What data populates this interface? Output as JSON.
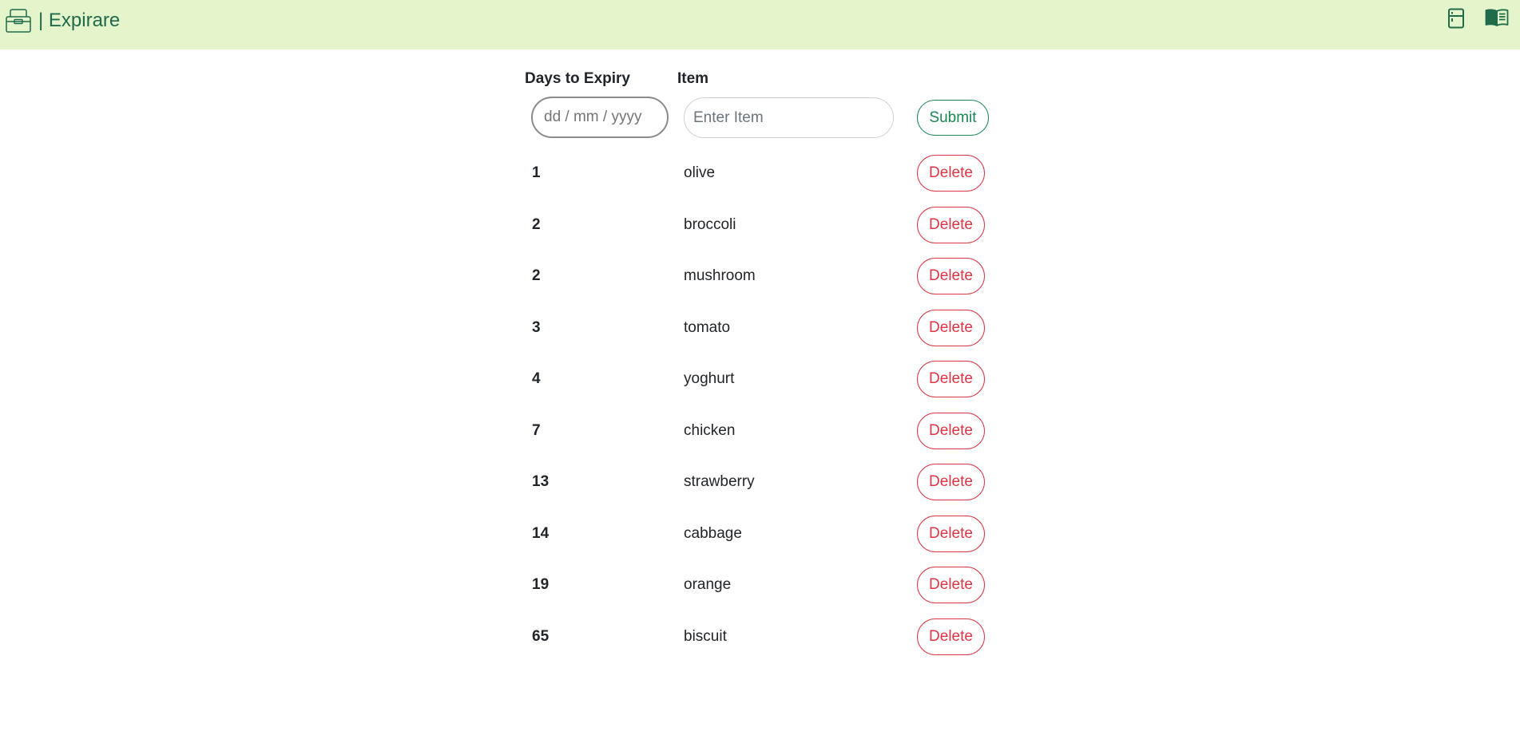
{
  "app": {
    "title": "| Expirare",
    "brand_icon": "lunchbox-icon",
    "nav_icons": [
      "fridge-icon",
      "book-icon"
    ],
    "accent_color": "#1f6b4a",
    "navbar_color": "#e4f5cc"
  },
  "form": {
    "days_header": "Days to Expiry",
    "item_header": "Item",
    "date_placeholder": "dd / mm / yyyy",
    "item_placeholder": "Enter Item",
    "submit_label": "Submit"
  },
  "items": [
    {
      "days": "1",
      "name": "olive",
      "delete_label": "Delete"
    },
    {
      "days": "2",
      "name": "broccoli",
      "delete_label": "Delete"
    },
    {
      "days": "2",
      "name": "mushroom",
      "delete_label": "Delete"
    },
    {
      "days": "3",
      "name": "tomato",
      "delete_label": "Delete"
    },
    {
      "days": "4",
      "name": "yoghurt",
      "delete_label": "Delete"
    },
    {
      "days": "7",
      "name": "chicken",
      "delete_label": "Delete"
    },
    {
      "days": "13",
      "name": "strawberry",
      "delete_label": "Delete"
    },
    {
      "days": "14",
      "name": "cabbage",
      "delete_label": "Delete"
    },
    {
      "days": "19",
      "name": "orange",
      "delete_label": "Delete"
    },
    {
      "days": "65",
      "name": "biscuit",
      "delete_label": "Delete"
    }
  ]
}
